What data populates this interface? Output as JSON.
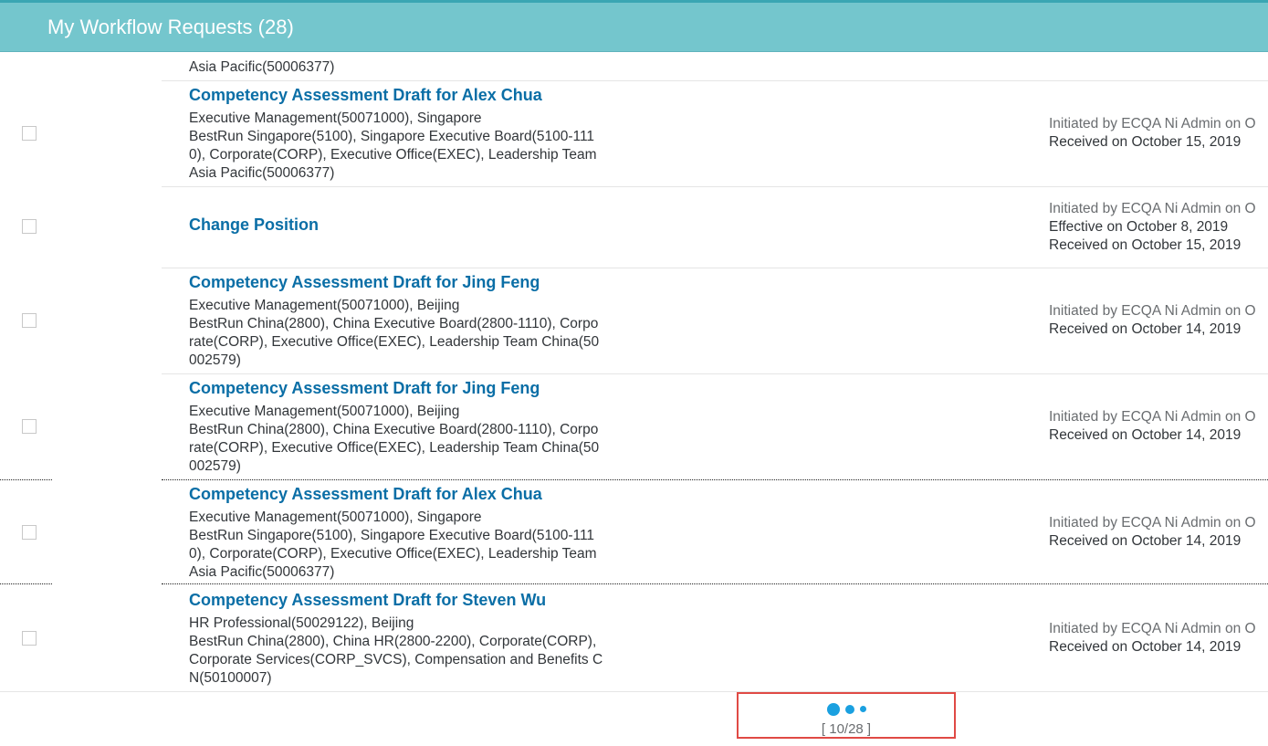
{
  "header": {
    "title": "My Workflow Requests (28)"
  },
  "partial_row": {
    "text": "Asia Pacific(50006377)"
  },
  "rows": [
    {
      "title": "Competency Assessment Draft for Alex Chua",
      "details": [
        "Executive Management(50071000), Singapore",
        "BestRun Singapore(5100), Singapore Executive Board(5100-111",
        "0), Corporate(CORP), Executive Office(EXEC), Leadership Team",
        "Asia Pacific(50006377)"
      ],
      "initiated": "Initiated by ECQA Ni Admin on O",
      "lines": [
        "Received on October 15, 2019"
      ]
    },
    {
      "title": "Change Position",
      "details": [],
      "initiated": "Initiated by ECQA Ni Admin on O",
      "lines": [
        "Effective on October 8, 2019",
        "Received on October 15, 2019"
      ]
    },
    {
      "title": "Competency Assessment Draft for Jing Feng",
      "details": [
        "Executive Management(50071000), Beijing",
        "BestRun China(2800), China Executive Board(2800-1110), Corpo",
        "rate(CORP), Executive Office(EXEC), Leadership Team China(50",
        "002579)"
      ],
      "initiated": "Initiated by ECQA Ni Admin on O",
      "lines": [
        "Received on October 14, 2019"
      ]
    },
    {
      "title": "Competency Assessment Draft for Jing Feng",
      "details": [
        "Executive Management(50071000), Beijing",
        "BestRun China(2800), China Executive Board(2800-1110), Corpo",
        "rate(CORP), Executive Office(EXEC), Leadership Team China(50",
        "002579)"
      ],
      "initiated": "Initiated by ECQA Ni Admin on O",
      "lines": [
        "Received on October 14, 2019"
      ]
    },
    {
      "title": "Competency Assessment Draft for Alex Chua",
      "details": [
        "Executive Management(50071000), Singapore",
        "BestRun Singapore(5100), Singapore Executive Board(5100-111",
        "0), Corporate(CORP), Executive Office(EXEC), Leadership Team",
        "Asia Pacific(50006377)"
      ],
      "initiated": "Initiated by ECQA Ni Admin on O",
      "lines": [
        "Received on October 14, 2019"
      ]
    },
    {
      "title": "Competency Assessment Draft for Steven Wu",
      "details": [
        "HR Professional(50029122), Beijing",
        "BestRun China(2800), China HR(2800-2200), Corporate(CORP),",
        "Corporate Services(CORP_SVCS), Compensation and Benefits C",
        "N(50100007)"
      ],
      "initiated": "Initiated by ECQA Ni Admin on O",
      "lines": [
        "Received on October 14, 2019"
      ]
    }
  ],
  "pager": {
    "count": "[ 10/28 ]"
  }
}
